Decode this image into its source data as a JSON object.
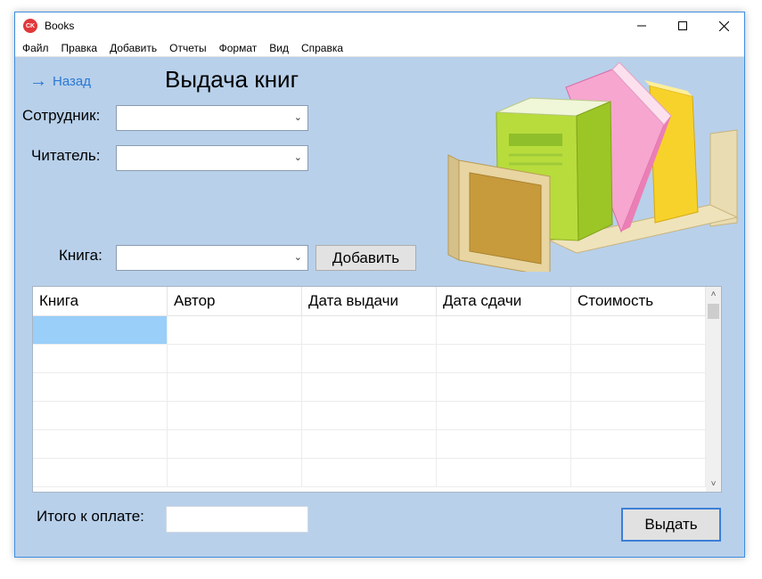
{
  "window": {
    "title": "Books",
    "app_icon_text": "CK"
  },
  "menu": [
    "Файл",
    "Правка",
    "Добавить",
    "Отчеты",
    "Формат",
    "Вид",
    "Справка"
  ],
  "back_link": {
    "label": "Назад",
    "icon": "arrow-right-icon"
  },
  "page_title": "Выдача книг",
  "form": {
    "employee_label": "Сотрудник:",
    "employee_value": "",
    "reader_label": "Читатель:",
    "reader_value": "",
    "book_label": "Книга:",
    "book_value": "",
    "add_button": "Добавить"
  },
  "table": {
    "columns": [
      "Книга",
      "Автор",
      "Дата выдачи",
      "Дата сдачи",
      "Стоимость"
    ],
    "rows": [
      [
        "",
        "",
        "",
        "",
        ""
      ],
      [
        "",
        "",
        "",
        "",
        ""
      ],
      [
        "",
        "",
        "",
        "",
        ""
      ],
      [
        "",
        "",
        "",
        "",
        ""
      ],
      [
        "",
        "",
        "",
        "",
        ""
      ],
      [
        "",
        "",
        "",
        "",
        ""
      ]
    ]
  },
  "total": {
    "label": "Итого к оплате:",
    "value": ""
  },
  "issue_button": "Выдать",
  "colors": {
    "window_bg": "#b8d0ea",
    "accent": "#2a78d4",
    "selection": "#99cff9"
  }
}
